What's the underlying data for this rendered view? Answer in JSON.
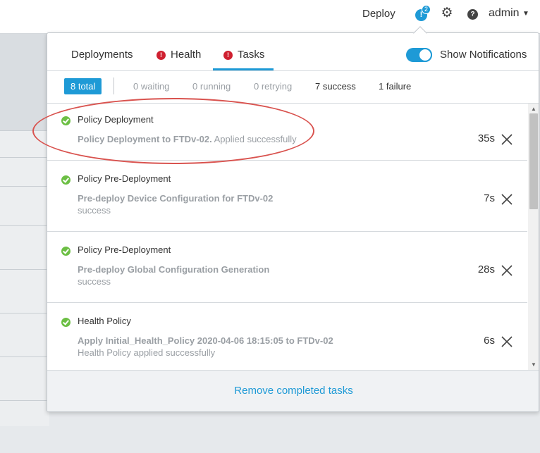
{
  "topbar": {
    "deploy_label": "Deploy",
    "notification_count": "2",
    "bell_glyph": "!",
    "help_glyph": "?",
    "user_label": "admin",
    "caret_glyph": "▼"
  },
  "popover": {
    "tabs": [
      {
        "label": "Deployments",
        "has_error": false
      },
      {
        "label": "Health",
        "has_error": true
      },
      {
        "label": "Tasks",
        "has_error": true,
        "active": true
      }
    ],
    "error_glyph": "!",
    "show_notifications_label": "Show Notifications",
    "show_notifications_on": true,
    "filters": {
      "total": "8 total",
      "waiting": "0 waiting",
      "running": "0 running",
      "retrying": "0 retrying",
      "success": "7 success",
      "failure": "1 failure"
    },
    "tasks": [
      {
        "title": "Policy Deployment",
        "desc_bold": "Policy Deployment to FTDv-02.",
        "desc_rest": " Applied successfully",
        "sub": "",
        "duration": "35s"
      },
      {
        "title": "Policy Pre-Deployment",
        "desc_bold": "Pre-deploy Device Configuration for FTDv-02",
        "desc_rest": "",
        "sub": "success",
        "duration": "7s"
      },
      {
        "title": "Policy Pre-Deployment",
        "desc_bold": "Pre-deploy Global Configuration Generation",
        "desc_rest": "",
        "sub": "success",
        "duration": "28s"
      },
      {
        "title": "Health Policy",
        "desc_bold": "Apply Initial_Health_Policy 2020-04-06 18:15:05 to FTDv-02",
        "desc_rest": "",
        "sub": "Health Policy applied successfully",
        "duration": "6s"
      }
    ],
    "remove_completed_label": "Remove completed tasks"
  },
  "colors": {
    "accent": "#1e9ad6",
    "error": "#cf2030",
    "success": "#6cbf44",
    "annotation": "#d9534f"
  }
}
